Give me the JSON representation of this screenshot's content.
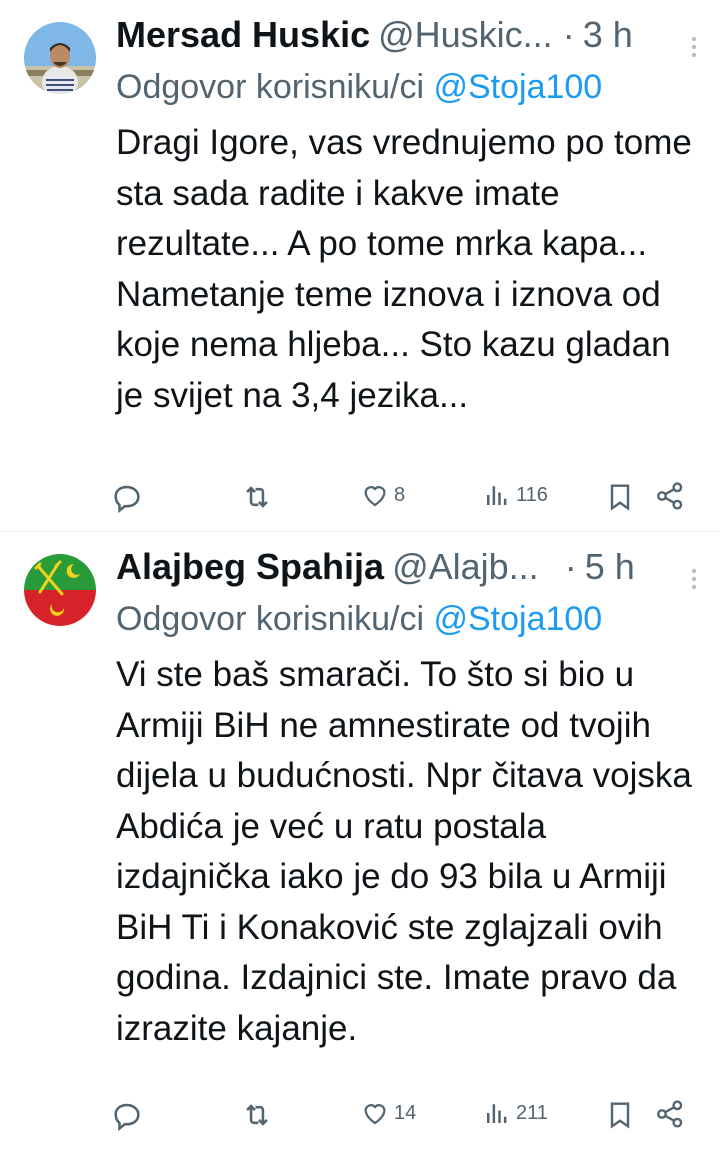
{
  "tweets": [
    {
      "author_name": "Mersad Huskic",
      "handle": "@Huskic...",
      "dot": "·",
      "time": "3 h",
      "reply_prefix": "Odgovor korisniku/ci",
      "reply_to": "@Stoja100",
      "body": "Dragi Igore, vas vrednujemo po tome sta sada radite i kakve imate rezultate... A po tome mrka kapa... Nametanje teme iznova i iznova od koje nema hljeba... Sto kazu gladan je svijet na 3,4 jezika...",
      "likes": "8",
      "views": "116"
    },
    {
      "author_name": "Alajbeg Spahija",
      "handle": "@Alajb...",
      "dot": "·",
      "time": "5 h",
      "reply_prefix": "Odgovor korisniku/ci",
      "reply_to": "@Stoja100",
      "body": "Vi ste baš smarači. To što si bio u Armiji BiH ne amnestirate od tvojih dijela u budućnosti. Npr čitava vojska Abdića je već u ratu postala izdajnička iako je do 93 bila u Armiji BiH Ti i Konaković ste zglajzali ovih godina. Izdajnici ste. Imate pravo da izrazite kajanje.",
      "likes": "14",
      "views": "211"
    }
  ],
  "icons": {
    "reply": "reply-icon",
    "retweet": "retweet-icon",
    "like": "heart-icon",
    "views": "views-icon",
    "bookmark": "bookmark-icon",
    "share": "share-icon",
    "more": "more-vertical-icon"
  },
  "colors": {
    "text": "#0f1419",
    "secondary": "#536471",
    "accent": "#1d9bf0",
    "flag_green": "#2a9b3a",
    "flag_red": "#d6232a",
    "flag_yellow": "#f2d21a"
  }
}
